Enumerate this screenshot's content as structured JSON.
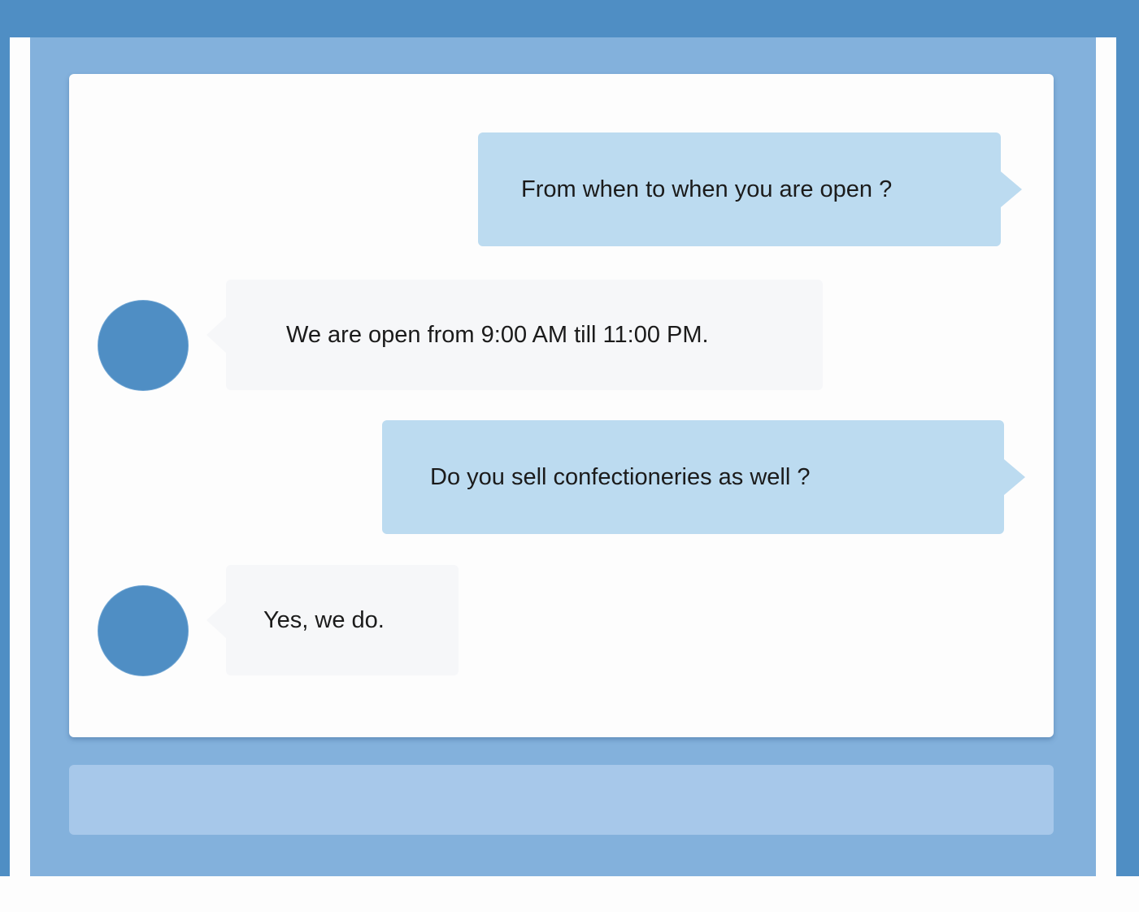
{
  "colors": {
    "frame_blue": "#4f8ec4",
    "app_background": "#83b1dc",
    "panel_background": "#fdfdfd",
    "user_bubble": "#bcdbf0",
    "bot_bubble": "#f6f7f9",
    "input_bar": "#a7c8ea",
    "avatar": "#4f8ec4"
  },
  "chat": {
    "messages": [
      {
        "sender": "user",
        "text": "From when to when you are open ?"
      },
      {
        "sender": "bot",
        "text": "We are open from 9:00 AM till 11:00 PM."
      },
      {
        "sender": "user",
        "text": "Do you sell confectioneries as well ?"
      },
      {
        "sender": "bot",
        "text": "Yes, we do."
      }
    ]
  },
  "input": {
    "value": "",
    "placeholder": ""
  }
}
